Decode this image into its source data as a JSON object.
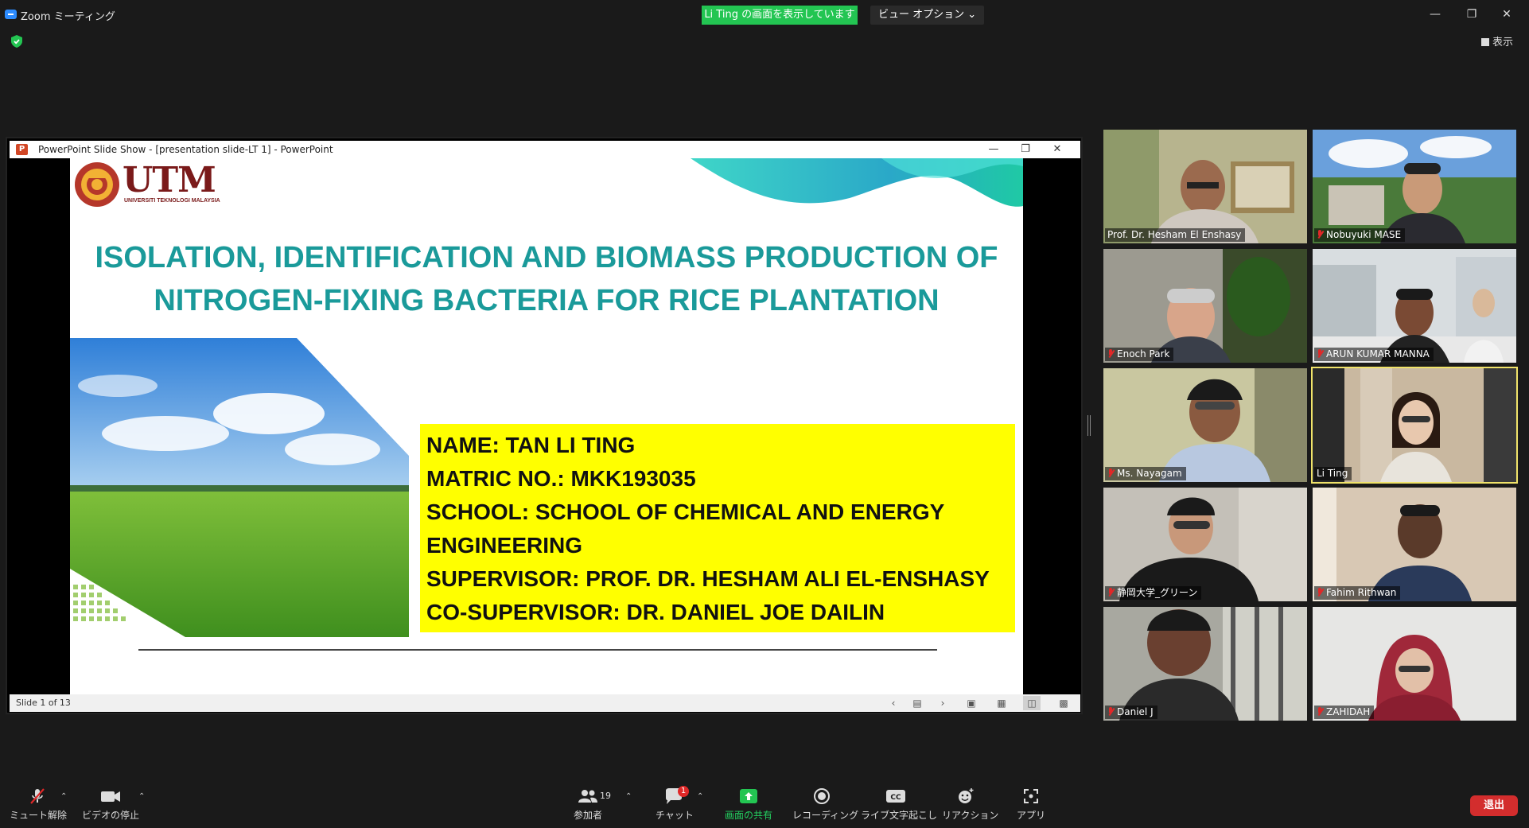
{
  "window": {
    "title": "Zoom ミーティング",
    "share_banner": "Li Ting の画面を表示しています",
    "view_options": "ビュー オプション ⌄",
    "view_toggle": "表示"
  },
  "ppt": {
    "window_title": "PowerPoint Slide Show - [presentation slide-LT 1] - PowerPoint",
    "status": "Slide 1 of 13"
  },
  "slide": {
    "logo_text": "UTM",
    "logo_subtext": "UNIVERSITI TEKNOLOGI MALAYSIA",
    "title_line1": "ISOLATION, IDENTIFICATION AND BIOMASS PRODUCTION OF",
    "title_line2": "NITROGEN-FIXING BACTERIA FOR RICE PLANTATION",
    "info": [
      "NAME: TAN LI TING",
      "MATRIC NO.: MKK193035",
      "SCHOOL: SCHOOL OF CHEMICAL AND ENERGY",
      "ENGINEERING",
      "SUPERVISOR: PROF. DR. HESHAM ALI EL-ENSHASY",
      "CO-SUPERVISOR: DR. DANIEL JOE DAILIN"
    ]
  },
  "participants": [
    {
      "name": "Prof. Dr. Hesham El Enshasy",
      "muted": false
    },
    {
      "name": "Nobuyuki MASE",
      "muted": true
    },
    {
      "name": "Enoch Park",
      "muted": true
    },
    {
      "name": "ARUN KUMAR MANNA",
      "muted": true
    },
    {
      "name": "Ms. Nayagam",
      "muted": true
    },
    {
      "name": "Li Ting",
      "muted": false
    },
    {
      "name": "静岡大学_グリーン",
      "muted": true
    },
    {
      "name": "Fahim Rithwan",
      "muted": true
    },
    {
      "name": "Daniel J",
      "muted": true
    },
    {
      "name": "ZAHIDAH",
      "muted": true
    }
  ],
  "toolbar": {
    "unmute": "ミュート解除",
    "stop_video": "ビデオの停止",
    "participants": "参加者",
    "participants_count": "19",
    "chat": "チャット",
    "chat_badge": "1",
    "share_screen": "画面の共有",
    "recording": "レコーディング",
    "live_transcript": "ライブ文字起こし",
    "reactions": "リアクション",
    "apps": "アプリ",
    "leave": "退出"
  },
  "colors": {
    "share_green": "#23c552",
    "leave_red": "#d32d2d",
    "title_teal": "#1a9a9a",
    "info_yellow": "#ffff00",
    "active_speaker": "#f0e36a"
  }
}
